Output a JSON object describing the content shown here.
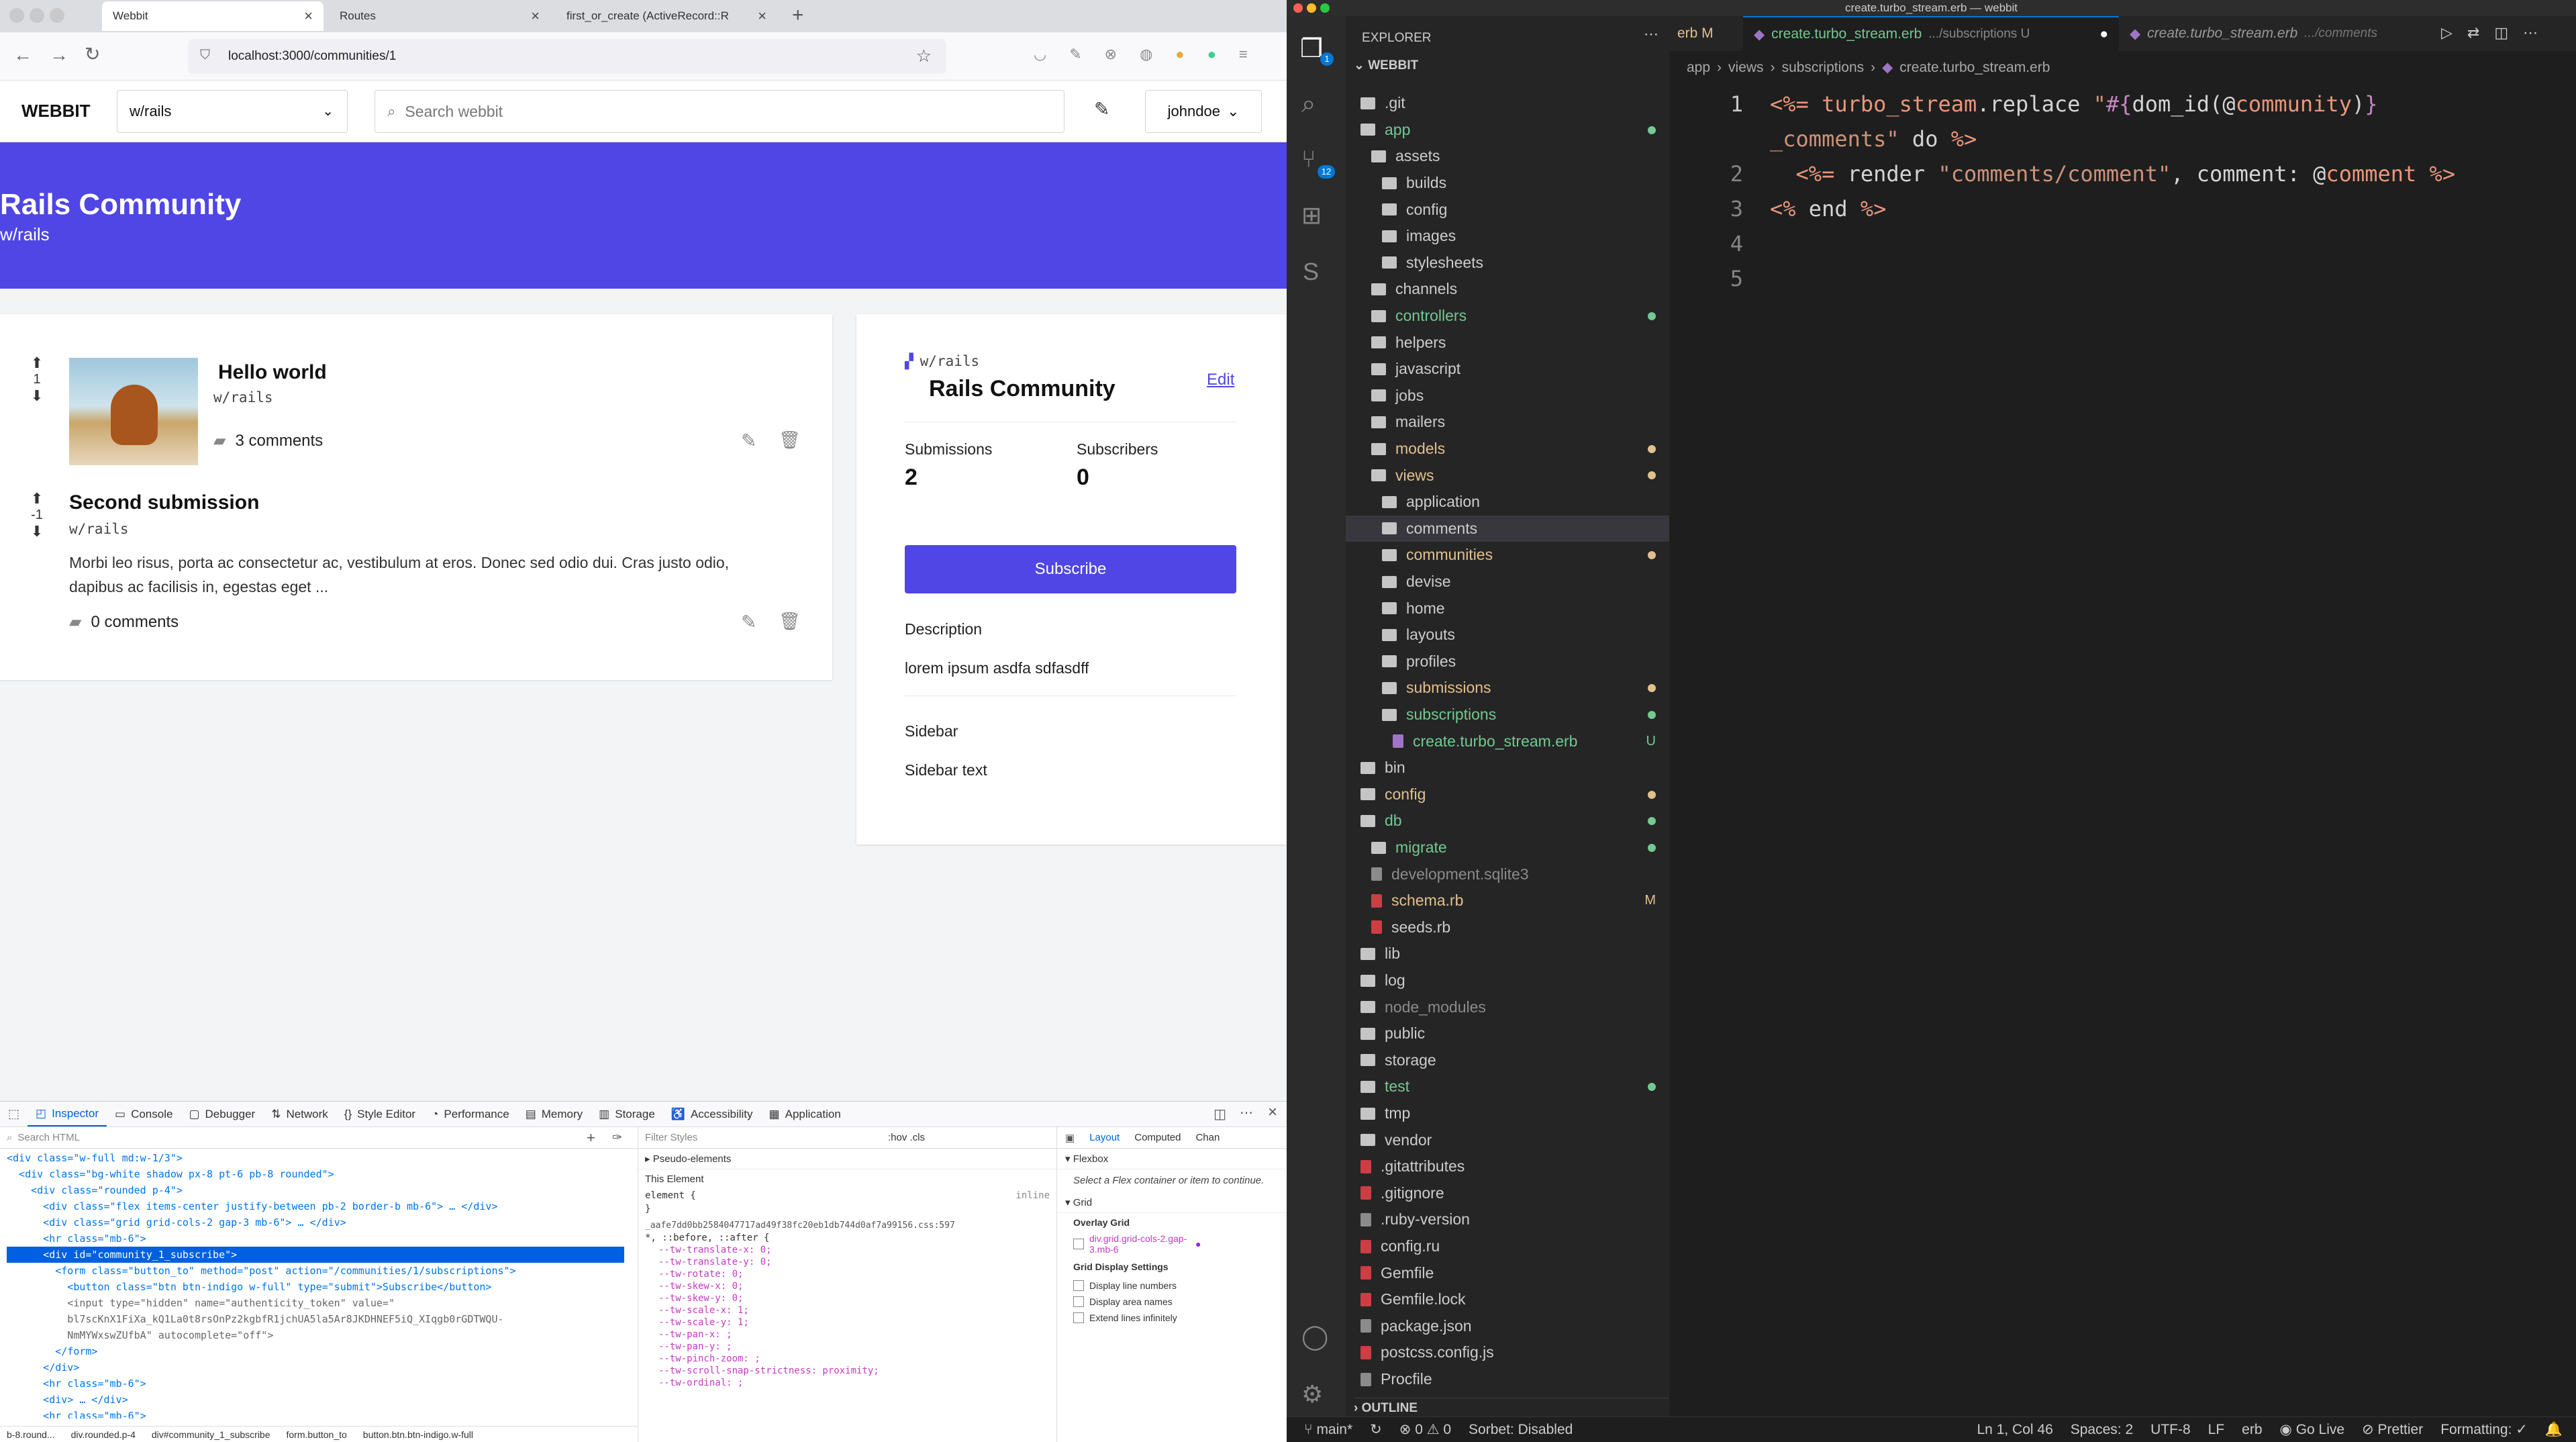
{
  "browser": {
    "tabs": [
      {
        "title": "Webbit",
        "active": true
      },
      {
        "title": "Routes",
        "active": false
      },
      {
        "title": "first_or_create (ActiveRecord::R",
        "active": false
      }
    ],
    "url": "localhost:3000/communities/1",
    "app": {
      "logo": "WEBBIT",
      "community_select": "w/rails",
      "search_placeholder": "Search webbit",
      "user": "johndoe",
      "banner_title": "Rails Community",
      "banner_sub": "w/rails",
      "posts": [
        {
          "score": "1",
          "title": "Hello world",
          "community": "w/rails",
          "comments": "3 comments",
          "body": ""
        },
        {
          "score": "-1",
          "title": "Second submission",
          "community": "w/rails",
          "comments": "0 comments",
          "body": "Morbi leo risus, porta ac consectetur ac, vestibulum at eros. Donec sed odio dui. Cras justo odio, dapibus ac facilisis in, egestas eget ..."
        }
      ],
      "sidebar": {
        "tag": "w/rails",
        "title": "Rails Community",
        "edit": "Edit",
        "submissions_label": "Submissions",
        "submissions_value": "2",
        "subscribers_label": "Subscribers",
        "subscribers_value": "0",
        "subscribe": "Subscribe",
        "description_label": "Description",
        "description": "lorem ipsum asdfa sdfasdff",
        "sidebar_label": "Sidebar",
        "sidebar_text": "Sidebar text"
      }
    },
    "devtools": {
      "tabs": [
        "Inspector",
        "Console",
        "Debugger",
        "Network",
        "Style Editor",
        "Performance",
        "Memory",
        "Storage",
        "Accessibility",
        "Application"
      ],
      "search_placeholder": "Search HTML",
      "html_lines": [
        "<div class=\"w-full md:w-1/3\">",
        "  <div class=\"bg-white shadow px-8 pt-6 pb-8 rounded\">",
        "    <div class=\"rounded p-4\">",
        "      <div class=\"flex items-center justify-between pb-2 border-b mb-6\"> … </div>",
        "      <div class=\"grid grid-cols-2 gap-3 mb-6\"> … </div>",
        "      <hr class=\"mb-6\">",
        "      <div id=\"community_1_subscribe\">",
        "        <form class=\"button_to\" method=\"post\" action=\"/communities/1/subscriptions\">",
        "          <button class=\"btn btn-indigo w-full\" type=\"submit\">Subscribe</button>",
        "          <input type=\"hidden\" name=\"authenticity_token\" value=\"",
        "          bl7scKnX1FiXa_kQ1La0t8rsOnPz2kgbfR1jchUA5la5Ar8JKDHNEF5iQ_XIqgb0rGDTWQU-",
        "          NmMYWxswZUfbA\" autocomplete=\"off\">",
        "        </form>",
        "      </div>",
        "      <hr class=\"mb-6\">",
        "      <div> … </div>",
        "      <hr class=\"mb-6\">"
      ],
      "filter_placeholder": "Filter Styles",
      "styles_tools": ":hov .cls",
      "pseudo": "Pseudo-elements",
      "this_element": "This Element",
      "element_rule": "element {",
      "inline": "inline",
      "css_file": "_aafe7dd0bb2584047717ad49f38fc20eb1db744d0af7a99156.css:597",
      "css_selector": "*, ::before, ::after {",
      "css_lines": [
        "--tw-translate-x: 0;",
        "--tw-translate-y: 0;",
        "--tw-rotate: 0;",
        "--tw-skew-x: 0;",
        "--tw-skew-y: 0;",
        "--tw-scale-x: 1;",
        "--tw-scale-y: 1;",
        "--tw-pan-x: ;",
        "--tw-pan-y: ;",
        "--tw-pinch-zoom: ;",
        "--tw-scroll-snap-strictness: proximity;",
        "--tw-ordinal: ;"
      ],
      "layout_tabs": [
        "Layout",
        "Computed",
        "Chan"
      ],
      "flexbox": "Flexbox",
      "flex_hint": "Select a Flex container or item to continue.",
      "grid": "Grid",
      "overlay_grid": "Overlay Grid",
      "grid_item": "div.grid.grid-cols-2.gap-3.mb-6",
      "grid_settings": "Grid Display Settings",
      "grid_opts": [
        "Display line numbers",
        "Display area names",
        "Extend lines infinitely"
      ],
      "breadcrumbs": [
        "b-8.round...",
        "div.rounded.p-4",
        "div#community_1_subscribe",
        "form.button_to",
        "button.btn.btn-indigo.w-full"
      ]
    }
  },
  "vscode": {
    "window_title": "create.turbo_stream.erb — webbit",
    "tabs": [
      {
        "label": "erb M",
        "partial": true
      },
      {
        "label": "create.turbo_stream.erb",
        "path": ".../subscriptions U",
        "active": true
      },
      {
        "label": "create.turbo_stream.erb",
        "path": ".../comments",
        "active": false
      }
    ],
    "explorer_title": "EXPLORER",
    "project": "WEBBIT",
    "breadcrumb": [
      "app",
      "views",
      "subscriptions",
      "create.turbo_stream.erb"
    ],
    "tree": [
      {
        "name": ".git",
        "indent": 0,
        "color": "#cccccc"
      },
      {
        "name": "app",
        "indent": 0,
        "color": "#73c991",
        "dot": "#73c991"
      },
      {
        "name": "assets",
        "indent": 1,
        "color": "#cccccc"
      },
      {
        "name": "builds",
        "indent": 2,
        "color": "#cccccc"
      },
      {
        "name": "config",
        "indent": 2,
        "color": "#cccccc"
      },
      {
        "name": "images",
        "indent": 2,
        "color": "#cccccc"
      },
      {
        "name": "stylesheets",
        "indent": 2,
        "color": "#cccccc"
      },
      {
        "name": "channels",
        "indent": 1,
        "color": "#cccccc"
      },
      {
        "name": "controllers",
        "indent": 1,
        "color": "#73c991",
        "dot": "#73c991"
      },
      {
        "name": "helpers",
        "indent": 1,
        "color": "#cccccc"
      },
      {
        "name": "javascript",
        "indent": 1,
        "color": "#cccccc"
      },
      {
        "name": "jobs",
        "indent": 1,
        "color": "#cccccc"
      },
      {
        "name": "mailers",
        "indent": 1,
        "color": "#cccccc"
      },
      {
        "name": "models",
        "indent": 1,
        "color": "#e2c08d",
        "dot": "#e2c08d"
      },
      {
        "name": "views",
        "indent": 1,
        "color": "#e2c08d",
        "dot": "#e2c08d"
      },
      {
        "name": "application",
        "indent": 2,
        "color": "#cccccc"
      },
      {
        "name": "comments",
        "indent": 2,
        "color": "#cccccc",
        "selected": true
      },
      {
        "name": "communities",
        "indent": 2,
        "color": "#e2c08d",
        "dot": "#e2c08d"
      },
      {
        "name": "devise",
        "indent": 2,
        "color": "#cccccc"
      },
      {
        "name": "home",
        "indent": 2,
        "color": "#cccccc"
      },
      {
        "name": "layouts",
        "indent": 2,
        "color": "#cccccc"
      },
      {
        "name": "profiles",
        "indent": 2,
        "color": "#cccccc"
      },
      {
        "name": "submissions",
        "indent": 2,
        "color": "#e2c08d",
        "dot": "#e2c08d"
      },
      {
        "name": "subscriptions",
        "indent": 2,
        "color": "#73c991",
        "dot": "#73c991"
      },
      {
        "name": "create.turbo_stream.erb",
        "indent": 3,
        "color": "#73c991",
        "badge": "U",
        "file": "#a074c4"
      },
      {
        "name": "bin",
        "indent": 0,
        "color": "#cccccc"
      },
      {
        "name": "config",
        "indent": 0,
        "color": "#e2c08d",
        "dot": "#e2c08d"
      },
      {
        "name": "db",
        "indent": 0,
        "color": "#73c991",
        "dot": "#73c991"
      },
      {
        "name": "migrate",
        "indent": 1,
        "color": "#73c991",
        "dot": "#73c991"
      },
      {
        "name": "development.sqlite3",
        "indent": 1,
        "color": "#8b8b8b",
        "file": "#8b8b8b"
      },
      {
        "name": "schema.rb",
        "indent": 1,
        "color": "#e2c08d",
        "badge": "M",
        "file": "#cc3e44"
      },
      {
        "name": "seeds.rb",
        "indent": 1,
        "color": "#cccccc",
        "file": "#cc3e44"
      },
      {
        "name": "lib",
        "indent": 0,
        "color": "#cccccc"
      },
      {
        "name": "log",
        "indent": 0,
        "color": "#cccccc"
      },
      {
        "name": "node_modules",
        "indent": 0,
        "color": "#8b8b8b"
      },
      {
        "name": "public",
        "indent": 0,
        "color": "#cccccc"
      },
      {
        "name": "storage",
        "indent": 0,
        "color": "#cccccc"
      },
      {
        "name": "test",
        "indent": 0,
        "color": "#73c991",
        "dot": "#73c991"
      },
      {
        "name": "tmp",
        "indent": 0,
        "color": "#cccccc"
      },
      {
        "name": "vendor",
        "indent": 0,
        "color": "#cccccc"
      },
      {
        "name": ".gitattributes",
        "indent": 0,
        "color": "#cccccc",
        "file": "#cc3e44"
      },
      {
        "name": ".gitignore",
        "indent": 0,
        "color": "#cccccc",
        "file": "#cc3e44"
      },
      {
        "name": ".ruby-version",
        "indent": 0,
        "color": "#cccccc",
        "file": "#8b8b8b"
      },
      {
        "name": "config.ru",
        "indent": 0,
        "color": "#cccccc",
        "file": "#cc3e44"
      },
      {
        "name": "Gemfile",
        "indent": 0,
        "color": "#cccccc",
        "file": "#cc3e44"
      },
      {
        "name": "Gemfile.lock",
        "indent": 0,
        "color": "#cccccc",
        "file": "#cc3e44"
      },
      {
        "name": "package.json",
        "indent": 0,
        "color": "#cccccc",
        "file": "#8b8b8b"
      },
      {
        "name": "postcss.config.js",
        "indent": 0,
        "color": "#cccccc",
        "file": "#cc3e44"
      },
      {
        "name": "Procfile",
        "indent": 0,
        "color": "#cccccc",
        "file": "#8b8b8b"
      }
    ],
    "outline": "OUTLINE",
    "line_numbers": [
      "1",
      "",
      "2",
      "3",
      "4",
      "5"
    ],
    "code_lines": [
      [
        {
          "t": "<%= ",
          "c": "#e9967a"
        },
        {
          "t": "turbo_stream",
          "c": "#e9967a"
        },
        {
          "t": ".replace ",
          "c": "#d4d4d4"
        },
        {
          "t": "\"",
          "c": "#ce9178"
        },
        {
          "t": "#{",
          "c": "#c586c0"
        },
        {
          "t": "dom_id(",
          "c": "#d4d4d4"
        },
        {
          "t": "@",
          "c": "#d4d4d4"
        },
        {
          "t": "community",
          "c": "#e9967a"
        },
        {
          "t": ")",
          "c": "#d4d4d4"
        },
        {
          "t": "}",
          "c": "#c586c0"
        }
      ],
      [
        {
          "t": "_comments\"",
          "c": "#ce9178"
        },
        {
          "t": " do ",
          "c": "#d4d4d4"
        },
        {
          "t": "%>",
          "c": "#e9967a"
        }
      ],
      [
        {
          "t": "  <%= ",
          "c": "#e9967a"
        },
        {
          "t": "render ",
          "c": "#d4d4d4"
        },
        {
          "t": "\"comments/comment\"",
          "c": "#ce9178"
        },
        {
          "t": ", comment: ",
          "c": "#d4d4d4"
        },
        {
          "t": "@",
          "c": "#d4d4d4"
        },
        {
          "t": "comment",
          "c": "#e9967a"
        },
        {
          "t": " %>",
          "c": "#e9967a"
        }
      ],
      [
        {
          "t": "<% ",
          "c": "#e9967a"
        },
        {
          "t": "end ",
          "c": "#d4d4d4"
        },
        {
          "t": "%>",
          "c": "#e9967a"
        }
      ],
      [],
      []
    ],
    "status": {
      "branch": "main*",
      "problems": "0 ⚠ 0",
      "sorbet": "Sorbet: Disabled",
      "position": "Ln 1, Col 46",
      "spaces": "Spaces: 2",
      "encoding": "UTF-8",
      "eol": "LF",
      "lang": "erb",
      "golive": "Go Live",
      "prettier": "Prettier",
      "formatting": "Formatting: ✓"
    },
    "activity_badges": {
      "explorer": "1",
      "scm": "12"
    }
  }
}
